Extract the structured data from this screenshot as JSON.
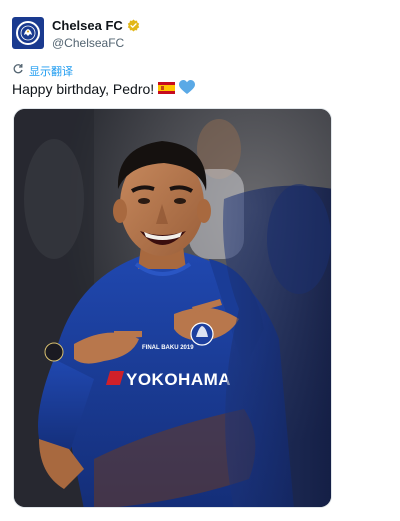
{
  "account": {
    "display_name": "Chelsea FC",
    "handle": "@ChelseaFC",
    "verified_icon": "gold-verified-badge-icon",
    "avatar_icon": "chelsea-lion-crest-icon",
    "brand_color": "#034694"
  },
  "translate": {
    "label": "显示翻译",
    "icon": "translate-refresh-icon"
  },
  "tweet": {
    "text": "Happy birthday, Pedro!",
    "emoji": [
      "spain-flag",
      "blue-heart"
    ]
  },
  "media": {
    "kit_text": {
      "sponsor": "YOKOHAMA",
      "final_patch": "FINAL BAKU 2019"
    }
  },
  "colors": {
    "link": "#1d9bf0",
    "secondary_text": "#536471",
    "kit_blue": "#1b3f9c"
  }
}
